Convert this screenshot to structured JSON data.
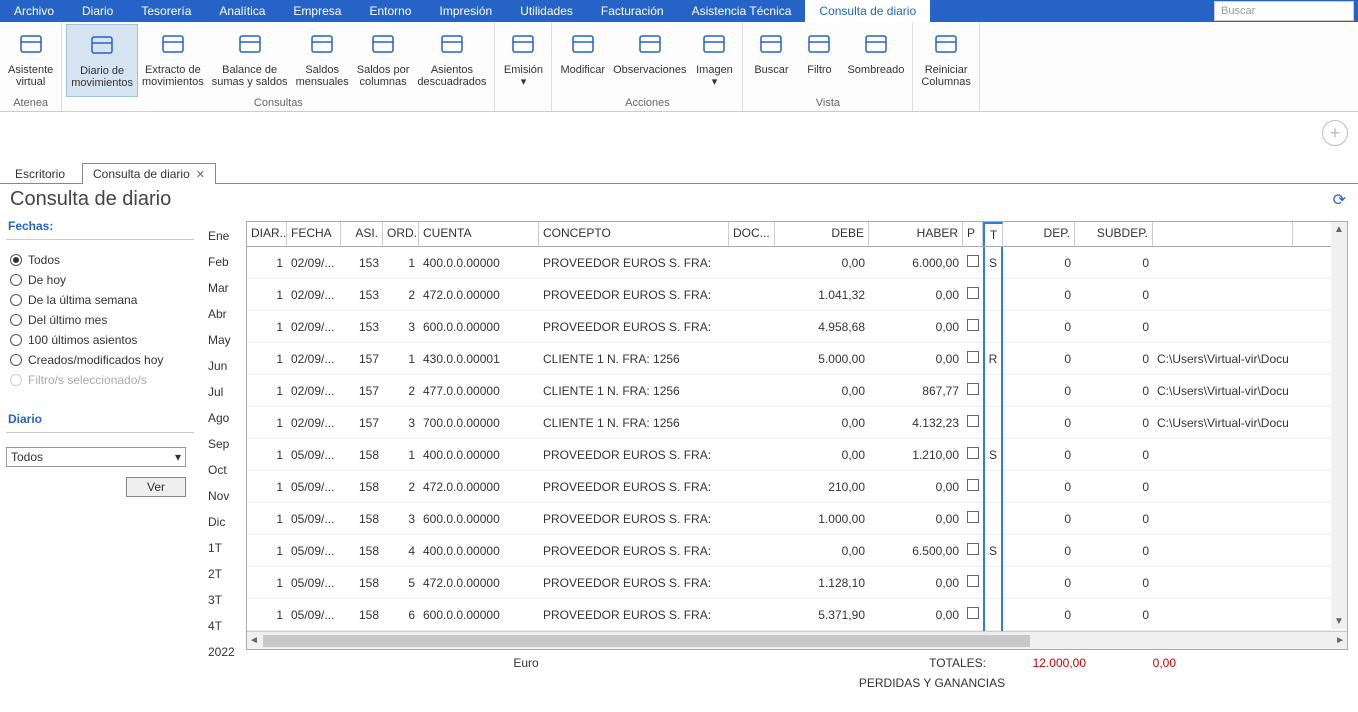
{
  "menu": [
    "Archivo",
    "Diario",
    "Tesorería",
    "Analítica",
    "Empresa",
    "Entorno",
    "Impresión",
    "Utilidades",
    "Facturación",
    "Asistencia Técnica",
    "Consulta de diario"
  ],
  "menu_active": 10,
  "search_placeholder": "Buscar",
  "ribbon": {
    "groups": [
      {
        "label": "Atenea",
        "buttons": [
          {
            "id": "asistente",
            "l1": "Asistente",
            "l2": "virtual"
          }
        ]
      },
      {
        "label": "Consultas",
        "buttons": [
          {
            "id": "diario-mov",
            "l1": "Diario de",
            "l2": "movimientos",
            "active": true
          },
          {
            "id": "extracto",
            "l1": "Extracto de",
            "l2": "movimientos"
          },
          {
            "id": "balance",
            "l1": "Balance de",
            "l2": "sumas y saldos"
          },
          {
            "id": "saldos-m",
            "l1": "Saldos",
            "l2": "mensuales"
          },
          {
            "id": "saldos-c",
            "l1": "Saldos por",
            "l2": "columnas"
          },
          {
            "id": "asientos-d",
            "l1": "Asientos",
            "l2": "descuadrados"
          }
        ]
      },
      {
        "label": "",
        "buttons": [
          {
            "id": "emision",
            "l1": "Emisión",
            "l2": "▾"
          }
        ]
      },
      {
        "label": "Acciones",
        "buttons": [
          {
            "id": "modificar",
            "l1": "Modificar",
            "l2": ""
          },
          {
            "id": "observ",
            "l1": "Observaciones",
            "l2": ""
          },
          {
            "id": "imagen",
            "l1": "Imagen",
            "l2": "▾"
          }
        ]
      },
      {
        "label": "Vista",
        "buttons": [
          {
            "id": "buscar",
            "l1": "Buscar",
            "l2": ""
          },
          {
            "id": "filtro",
            "l1": "Filtro",
            "l2": ""
          },
          {
            "id": "sombreado",
            "l1": "Sombreado",
            "l2": ""
          }
        ]
      },
      {
        "label": "",
        "buttons": [
          {
            "id": "reiniciar",
            "l1": "Reiniciar",
            "l2": "Columnas"
          }
        ]
      }
    ]
  },
  "tabs": [
    {
      "label": "Escritorio",
      "close": false
    },
    {
      "label": "Consulta de diario",
      "close": true
    }
  ],
  "page_title": "Consulta de diario",
  "filters": {
    "header": "Fechas:",
    "options": [
      "Todos",
      "De hoy",
      "De la última semana",
      "Del último mes",
      "100 últimos asientos",
      "Creados/modificados hoy",
      "Filtro/s seleccionado/s"
    ],
    "selected": 0,
    "diario_label": "Diario",
    "combo": "Todos",
    "ver": "Ver"
  },
  "months": [
    "Ene",
    "Feb",
    "Mar",
    "Abr",
    "May",
    "Jun",
    "Jul",
    "Ago",
    "Sep",
    "Oct",
    "Nov",
    "Dic",
    "1T",
    "2T",
    "3T",
    "4T",
    "2022"
  ],
  "grid": {
    "headers": [
      "DIAR..",
      "FECHA",
      "ASI.",
      "ORD.",
      "CUENTA",
      "CONCEPTO",
      "DOC...",
      "DEBE",
      "HABER",
      "P",
      "T",
      "DEP.",
      "SUBDEP.",
      ""
    ],
    "widths": [
      40,
      54,
      42,
      36,
      120,
      190,
      46,
      94,
      94,
      20,
      20,
      72,
      78,
      140
    ],
    "rows": [
      {
        "d": "1",
        "f": "02/09/...",
        "a": "153",
        "o": "1",
        "cu": "400.0.0.00000",
        "co": "PROVEEDOR EUROS S. FRA:",
        "doc": "",
        "de": "0,00",
        "ha": "6.000,00",
        "t": "S",
        "dep": "0",
        "sub": "0",
        "img": ""
      },
      {
        "d": "1",
        "f": "02/09/...",
        "a": "153",
        "o": "2",
        "cu": "472.0.0.00000",
        "co": "PROVEEDOR EUROS S. FRA:",
        "doc": "",
        "de": "1.041,32",
        "ha": "0,00",
        "t": "",
        "dep": "0",
        "sub": "0",
        "img": ""
      },
      {
        "d": "1",
        "f": "02/09/...",
        "a": "153",
        "o": "3",
        "cu": "600.0.0.00000",
        "co": "PROVEEDOR EUROS S. FRA:",
        "doc": "",
        "de": "4.958,68",
        "ha": "0,00",
        "t": "",
        "dep": "0",
        "sub": "0",
        "img": ""
      },
      {
        "d": "1",
        "f": "02/09/...",
        "a": "157",
        "o": "1",
        "cu": "430.0.0.00001",
        "co": "CLIENTE 1 N. FRA:  1256",
        "doc": "",
        "de": "5.000,00",
        "ha": "0,00",
        "t": "R",
        "dep": "0",
        "sub": "0",
        "img": "C:\\Users\\Virtual-vir\\Docu"
      },
      {
        "d": "1",
        "f": "02/09/...",
        "a": "157",
        "o": "2",
        "cu": "477.0.0.00000",
        "co": "CLIENTE 1 N. FRA:  1256",
        "doc": "",
        "de": "0,00",
        "ha": "867,77",
        "t": "",
        "dep": "0",
        "sub": "0",
        "img": "C:\\Users\\Virtual-vir\\Docu"
      },
      {
        "d": "1",
        "f": "02/09/...",
        "a": "157",
        "o": "3",
        "cu": "700.0.0.00000",
        "co": "CLIENTE 1 N. FRA:  1256",
        "doc": "",
        "de": "0,00",
        "ha": "4.132,23",
        "t": "",
        "dep": "0",
        "sub": "0",
        "img": "C:\\Users\\Virtual-vir\\Docu"
      },
      {
        "d": "1",
        "f": "05/09/...",
        "a": "158",
        "o": "1",
        "cu": "400.0.0.00000",
        "co": "PROVEEDOR EUROS S. FRA:",
        "doc": "",
        "de": "0,00",
        "ha": "1.210,00",
        "t": "S",
        "dep": "0",
        "sub": "0",
        "img": ""
      },
      {
        "d": "1",
        "f": "05/09/...",
        "a": "158",
        "o": "2",
        "cu": "472.0.0.00000",
        "co": "PROVEEDOR EUROS S. FRA:",
        "doc": "",
        "de": "210,00",
        "ha": "0,00",
        "t": "",
        "dep": "0",
        "sub": "0",
        "img": ""
      },
      {
        "d": "1",
        "f": "05/09/...",
        "a": "158",
        "o": "3",
        "cu": "600.0.0.00000",
        "co": "PROVEEDOR EUROS S. FRA:",
        "doc": "",
        "de": "1.000,00",
        "ha": "0,00",
        "t": "",
        "dep": "0",
        "sub": "0",
        "img": ""
      },
      {
        "d": "1",
        "f": "05/09/...",
        "a": "158",
        "o": "4",
        "cu": "400.0.0.00000",
        "co": "PROVEEDOR EUROS S. FRA:",
        "doc": "",
        "de": "0,00",
        "ha": "6.500,00",
        "t": "S",
        "dep": "0",
        "sub": "0",
        "img": ""
      },
      {
        "d": "1",
        "f": "05/09/...",
        "a": "158",
        "o": "5",
        "cu": "472.0.0.00000",
        "co": "PROVEEDOR EUROS S. FRA:",
        "doc": "",
        "de": "1.128,10",
        "ha": "0,00",
        "t": "",
        "dep": "0",
        "sub": "0",
        "img": ""
      },
      {
        "d": "1",
        "f": "05/09/...",
        "a": "158",
        "o": "6",
        "cu": "600.0.0.00000",
        "co": "PROVEEDOR EUROS S. FRA:",
        "doc": "",
        "de": "5.371,90",
        "ha": "0,00",
        "t": "",
        "dep": "0",
        "sub": "0",
        "img": ""
      }
    ]
  },
  "totals": {
    "currency": "Euro",
    "label": "TOTALES:",
    "debe": "12.000,00",
    "haber": "0,00"
  },
  "footer": "PERDIDAS Y GANANCIAS"
}
